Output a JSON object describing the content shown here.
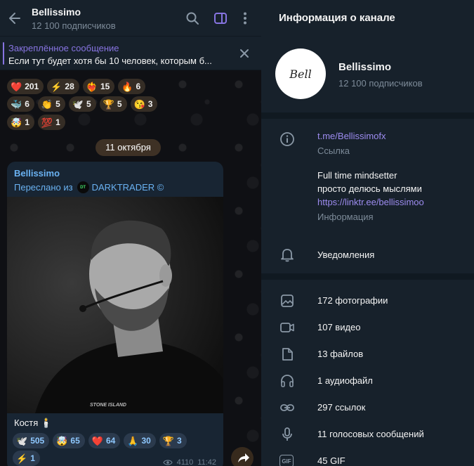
{
  "chat": {
    "title": "Bellissimo",
    "subscribers": "12 100 подписчиков",
    "pinned": {
      "title": "Закреплённое сообщение",
      "text": "Если тут будет хотя бы 10 человек, которым б..."
    },
    "reactions_row1": [
      {
        "emoji": "❤️",
        "count": "201"
      },
      {
        "emoji": "⚡",
        "count": "28"
      },
      {
        "emoji": "❤️‍🔥",
        "count": "15"
      },
      {
        "emoji": "🔥",
        "count": "6"
      }
    ],
    "reactions_row2": [
      {
        "emoji": "🐳",
        "count": "6"
      },
      {
        "emoji": "👏",
        "count": "5"
      },
      {
        "emoji": "🕊️",
        "count": "5"
      },
      {
        "emoji": "🏆",
        "count": "5"
      },
      {
        "emoji": "😘",
        "count": "3"
      }
    ],
    "reactions_row3": [
      {
        "emoji": "🤯",
        "count": "1"
      },
      {
        "emoji": "💯",
        "count": "1"
      }
    ],
    "date_pill": "11 октября",
    "message": {
      "author": "Bellissimo",
      "forwarded_prefix": "Переслано из",
      "forwarded_source": "DARKTRADER ©",
      "text": "Костя 🕯️",
      "reactions_row1": [
        {
          "emoji": "🕊️",
          "count": "505"
        },
        {
          "emoji": "🤯",
          "count": "65"
        },
        {
          "emoji": "❤️",
          "count": "64"
        },
        {
          "emoji": "🙏",
          "count": "30"
        },
        {
          "emoji": "🏆",
          "count": "3"
        }
      ],
      "reactions_row2": [
        {
          "emoji": "⚡",
          "count": "1"
        }
      ],
      "views": "4110",
      "time": "11:42"
    }
  },
  "info": {
    "panel_title": "Информация о канале",
    "avatar_text": "Bell",
    "name": "Bellissimo",
    "subscribers": "12 100 подписчиков",
    "link": "t.me/Bellissimofx",
    "link_caption": "Ссылка",
    "about_line1": "Full time mindsetter",
    "about_line2": "просто делюсь мыслями",
    "about_link": "https://linktr.ee/bellissimoo",
    "about_caption": "Информация",
    "notifications": "Уведомления",
    "media": [
      {
        "icon": "photo-icon",
        "label": "172 фотографии"
      },
      {
        "icon": "video-icon",
        "label": "107 видео"
      },
      {
        "icon": "file-icon",
        "label": "13 файлов"
      },
      {
        "icon": "headphones-icon",
        "label": "1 аудиофайл"
      },
      {
        "icon": "link-icon",
        "label": "297 ссылок"
      },
      {
        "icon": "microphone-icon",
        "label": "11 голосовых сообщений"
      },
      {
        "icon": "gif-icon",
        "label": "45 GIF"
      }
    ]
  },
  "colors": {
    "accent": "#8774e1",
    "link": "#6ab2f2",
    "panel_bg": "#17212b"
  }
}
